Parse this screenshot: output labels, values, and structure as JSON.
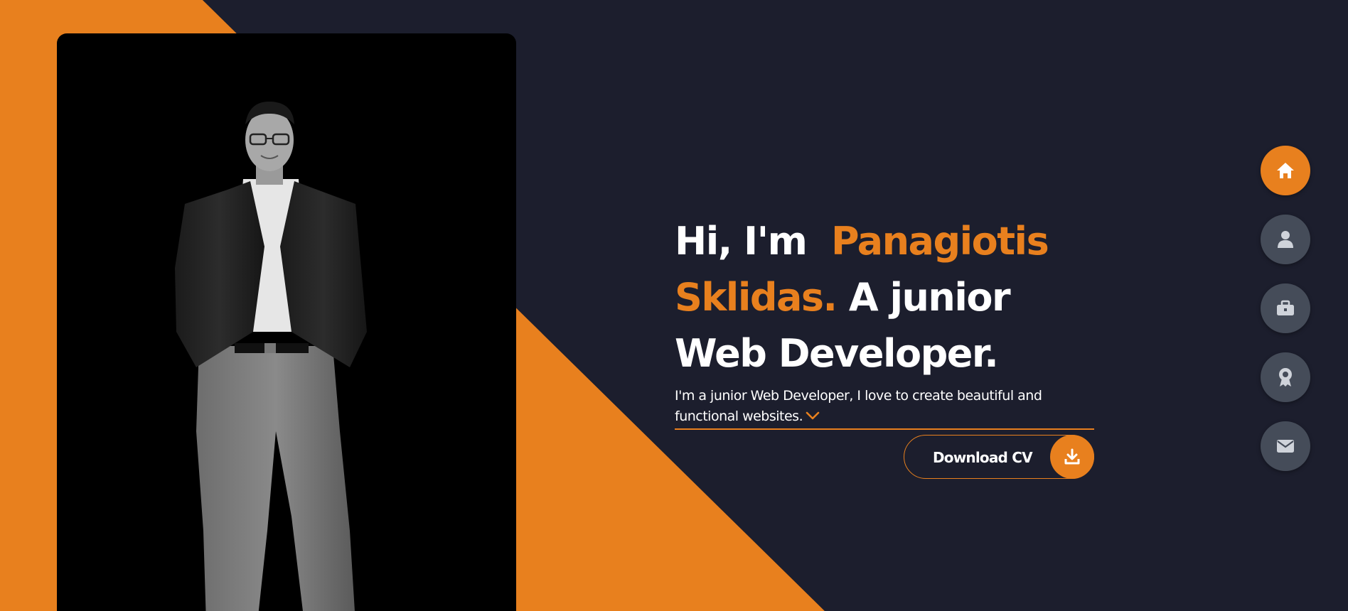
{
  "colors": {
    "background": "#1c1e2d",
    "accent": "#e8801e",
    "nav_inactive": "#454c59",
    "text": "#ffffff"
  },
  "hero": {
    "headline_greeting": "Hi, I'm",
    "headline_name": "Panagiotis Sklidas.",
    "headline_rest": "A junior Web Developer.",
    "subtext": "I'm a junior Web Developer, I love to create beautiful and functional websites.",
    "expand_icon": "chevron-down-icon"
  },
  "download_button": {
    "label": "Download CV",
    "icon": "download-icon"
  },
  "side_nav": {
    "items": [
      {
        "name": "home",
        "icon": "home-icon",
        "active": true
      },
      {
        "name": "about",
        "icon": "user-icon",
        "active": false
      },
      {
        "name": "portfolio",
        "icon": "briefcase-icon",
        "active": false
      },
      {
        "name": "certificates",
        "icon": "award-icon",
        "active": false
      },
      {
        "name": "contact",
        "icon": "envelope-icon",
        "active": false
      }
    ]
  },
  "profile_photo": {
    "subject": "portrait-photo"
  }
}
